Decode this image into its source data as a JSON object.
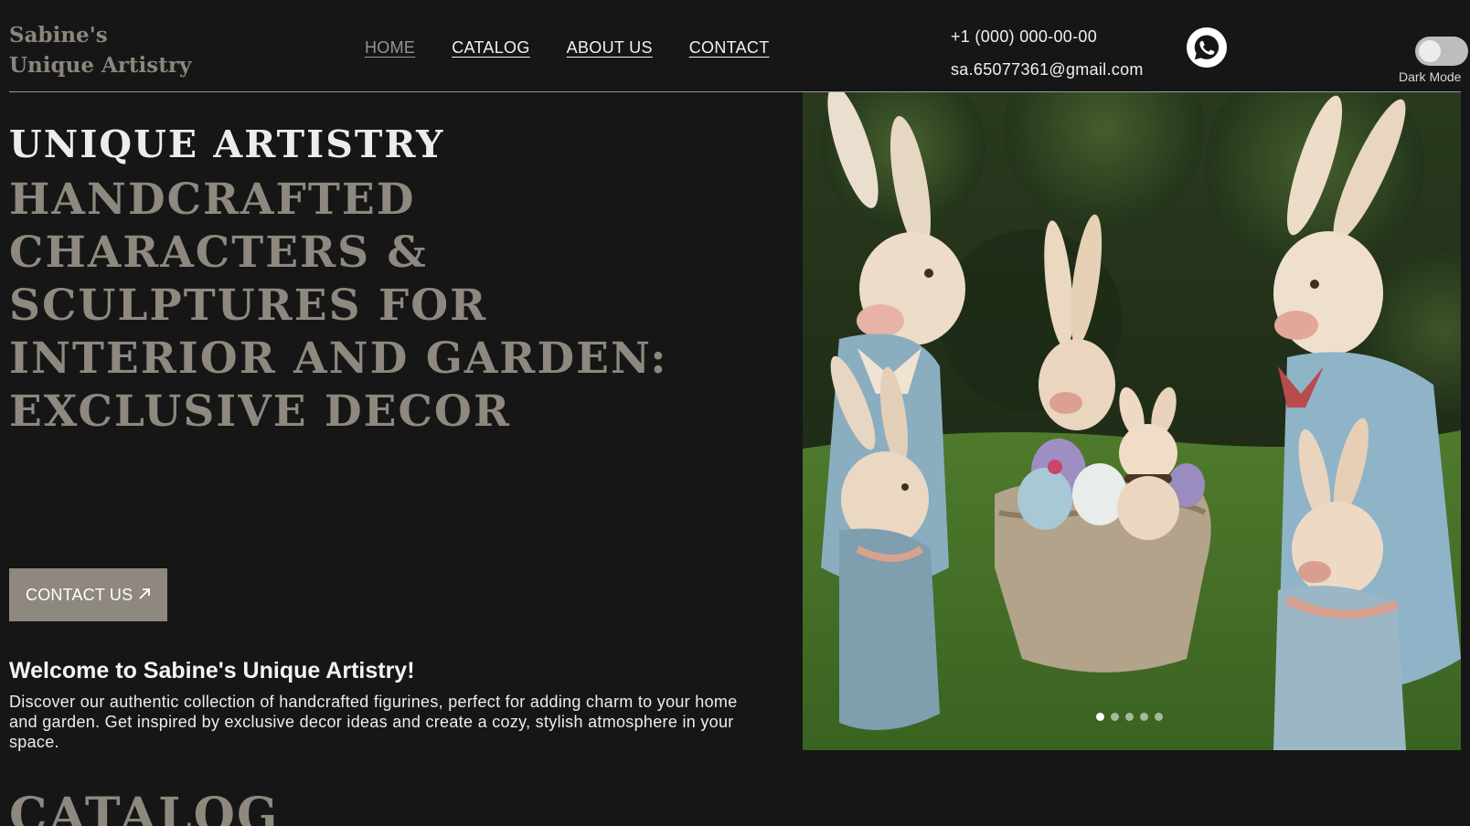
{
  "brand": {
    "line1": "Sabine's",
    "line2": "Unique Artistry"
  },
  "nav": {
    "items": [
      {
        "label": "HOME",
        "active": true
      },
      {
        "label": "CATALOG",
        "active": false
      },
      {
        "label": "ABOUT US",
        "active": false
      },
      {
        "label": "CONTACT",
        "active": false
      }
    ]
  },
  "contacts": {
    "phone": "+1 (000) 000-00-00",
    "email": "sa.65077361@gmail.com",
    "whatsapp_icon": "whatsapp-icon"
  },
  "theme_toggle": {
    "label": "Dark Mode",
    "on": false
  },
  "hero": {
    "kicker": "UNIQUE ARTISTRY",
    "title": "HANDCRAFTED CHARACTERS & SCULPTURES FOR INTERIOR AND GARDEN: EXCLUSIVE DECOR",
    "cta_label": "CONTACT US",
    "cta_icon": "arrow-up-right-icon"
  },
  "welcome": {
    "title": "Welcome to Sabine's Unique Artistry!",
    "text": "Discover our authentic collection of handcrafted figurines, perfect for adding charm to your home and garden. Get inspired by exclusive decor ideas and create a cozy, stylish atmosphere in your space."
  },
  "carousel": {
    "slide_count": 5,
    "active_index": 0
  },
  "catalog": {
    "heading": "CATALOG"
  },
  "colors": {
    "background": "#161616",
    "accent": "#8e887e",
    "text": "#ececec"
  }
}
